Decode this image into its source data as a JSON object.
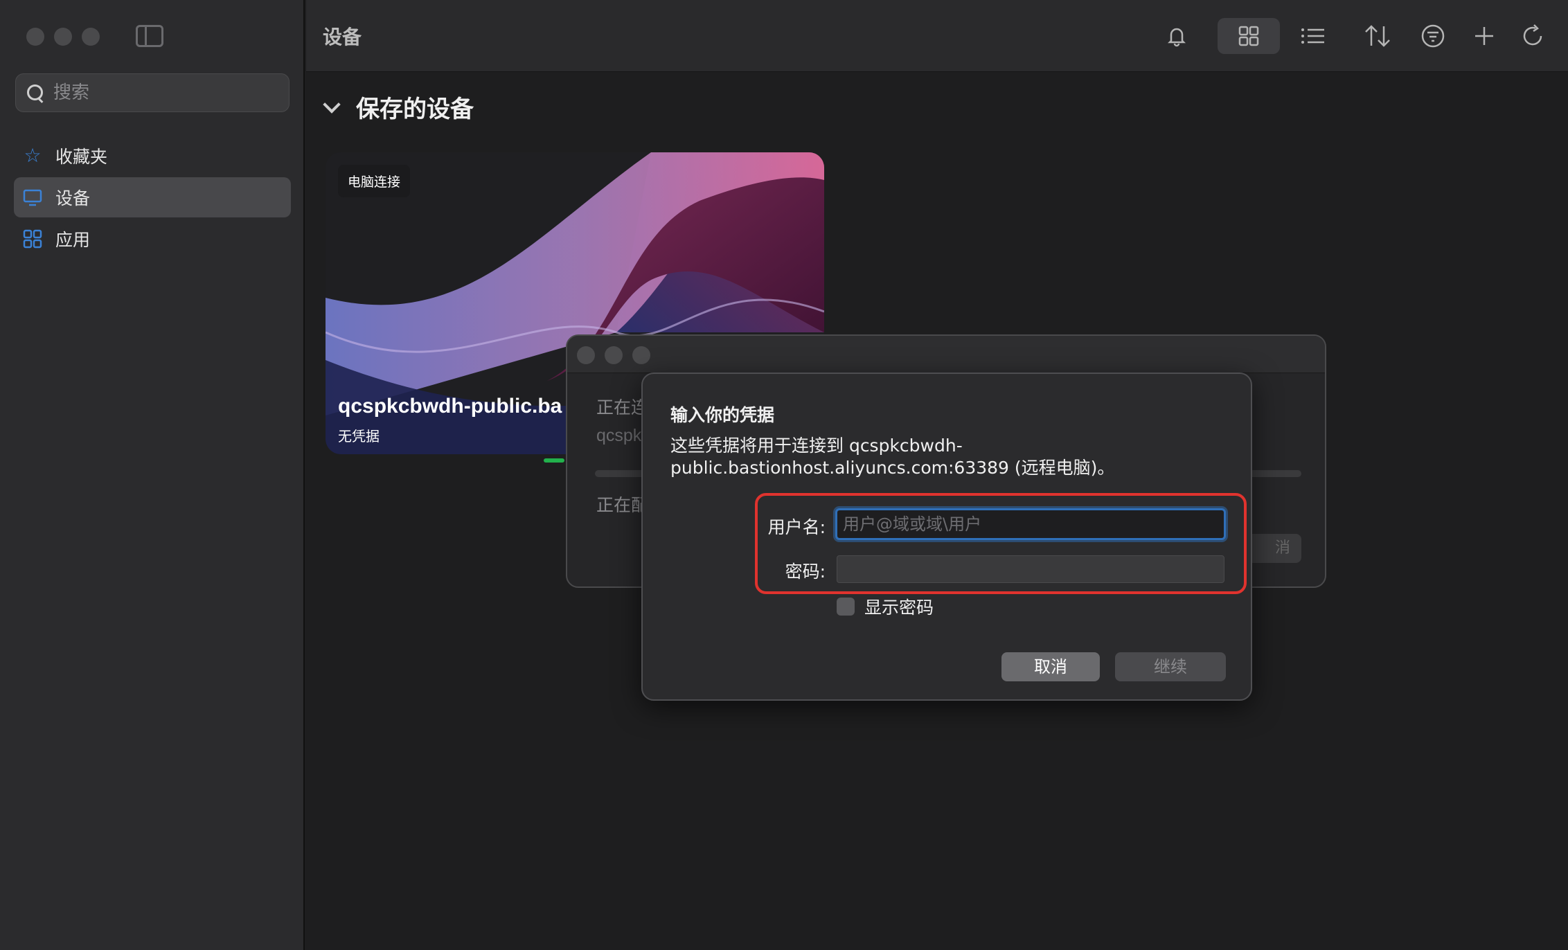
{
  "app": {
    "window_title": "设备"
  },
  "sidebar": {
    "search_placeholder": "搜索",
    "items": [
      {
        "label": "收藏夹",
        "icon": "star-icon",
        "active": false
      },
      {
        "label": "设备",
        "icon": "monitor-icon",
        "active": true
      },
      {
        "label": "应用",
        "icon": "apps-grid-icon",
        "active": false
      }
    ]
  },
  "toolbar": {
    "icons": [
      "bell-icon",
      "grid-view-icon",
      "list-view-icon",
      "sort-icon",
      "filter-icon",
      "add-icon",
      "refresh-icon"
    ]
  },
  "section": {
    "title": "保存的设备"
  },
  "device_card": {
    "badge": "电脑连接",
    "name": "qcspkcbwdh-public.ba",
    "subtitle": "无凭据"
  },
  "connect_window": {
    "status1": "正在连",
    "host": "qcspk",
    "status2": "正在配",
    "cancel": "消"
  },
  "dialog": {
    "title": "输入你的凭据",
    "description": "这些凭据将用于连接到 qcspkcbwdh-public.bastionhost.aliyuncs.com:63389 (远程电脑)。",
    "username_label": "用户名:",
    "username_placeholder": "用户@域或域\\用户",
    "username_value": "",
    "password_label": "密码:",
    "password_value": "",
    "show_password_label": "显示密码",
    "show_password_checked": false,
    "cancel_button": "取消",
    "continue_button": "继续"
  },
  "colors": {
    "accent": "#3b82d6",
    "highlight": "#e0332e",
    "progress": "#22b14c"
  }
}
